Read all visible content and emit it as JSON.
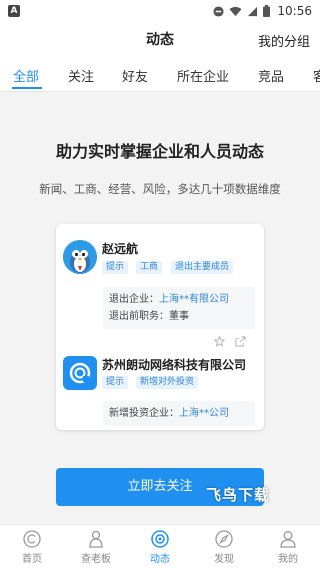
{
  "status_bar": {
    "app_badge": "A",
    "time": "10:56",
    "icons": [
      "dnd-icon",
      "wifi-icon",
      "signal-icon",
      "battery-icon"
    ]
  },
  "header": {
    "title": "动态",
    "right_link": "我的分组"
  },
  "tabs": [
    {
      "label": "全部",
      "active": true
    },
    {
      "label": "关注",
      "active": false
    },
    {
      "label": "好友",
      "active": false
    },
    {
      "label": "所在企业",
      "active": false
    },
    {
      "label": "竞品",
      "active": false
    },
    {
      "label": "客",
      "active": false
    }
  ],
  "hero": {
    "title": "助力实时掌握企业和人员动态",
    "subtitle": "新闻、工商、经营、风险，多达几十项数据维度"
  },
  "card": {
    "person": {
      "name": "赵远航",
      "tags": [
        "提示",
        "工商",
        "退出主要成员"
      ],
      "rows": [
        {
          "label": "退出企业：",
          "value": "上海**有限公司",
          "is_link": true
        },
        {
          "label": "退出前职务：",
          "value": "董事",
          "is_link": false
        }
      ]
    },
    "company": {
      "name": "苏州朗动网络科技有限公司",
      "tags": [
        "提示",
        "新增对外投资"
      ],
      "rows": [
        {
          "label": "新增投资企业：",
          "value": "上海**公司",
          "is_link": true
        }
      ]
    }
  },
  "follow_button": "立即去关注",
  "watermark": "飞鸟下载",
  "bottom_nav": [
    {
      "label": "首页",
      "icon": "home-c-icon",
      "active": false
    },
    {
      "label": "查老板",
      "icon": "person-icon",
      "active": false
    },
    {
      "label": "动态",
      "icon": "radar-icon",
      "active": true
    },
    {
      "label": "发现",
      "icon": "compass-icon",
      "active": false
    },
    {
      "label": "我的",
      "icon": "user-icon",
      "active": false
    }
  ],
  "colors": {
    "accent": "#1f8ff0",
    "tag_bg": "#e8f2fc",
    "page_bg": "#f3f3f3"
  }
}
